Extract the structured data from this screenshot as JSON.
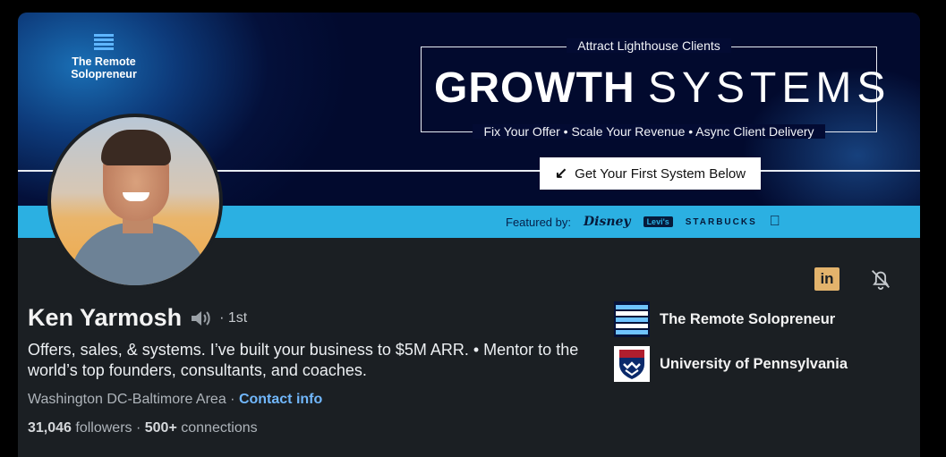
{
  "banner": {
    "brand_name": "The Remote Solopreneur",
    "tagline_top": "Attract Lighthouse Clients",
    "title_bold": "GROWTH",
    "title_light": "SYSTEMS",
    "tagline_bottom": "Fix Your Offer • Scale Your Revenue • Async Client Delivery",
    "cta_label": "Get Your First System Below",
    "featured_label": "Featured by:",
    "featured_logos": [
      "Disney",
      "Levi's",
      "STARBUCKS",
      "Apple"
    ]
  },
  "profile": {
    "name": "Ken Yarmosh",
    "degree": "· 1st",
    "headline": "Offers, sales, & systems. I’ve built your business to $5M ARR. • Mentor to the world’s top founders, consultants, and coaches.",
    "location": "Washington DC-Baltimore Area",
    "location_sep": " · ",
    "contact_info": "Contact info",
    "followers_count": "31,046",
    "followers_label": "followers",
    "stats_sep": " · ",
    "connections_count": "500+",
    "connections_label": "connections"
  },
  "orgs": [
    {
      "name": "The Remote Solopreneur"
    },
    {
      "name": "University of Pennsylvania"
    }
  ],
  "colors": {
    "banner_dark": "#020a2e",
    "featured_bar": "#2bb0e2",
    "card_bg": "#1b1f23",
    "link": "#71b7fb",
    "linkedin_badge": "#e3b36c"
  },
  "icons": {
    "linkedin": "in",
    "bell": "bell-off-icon",
    "speaker": "speaker-icon"
  }
}
